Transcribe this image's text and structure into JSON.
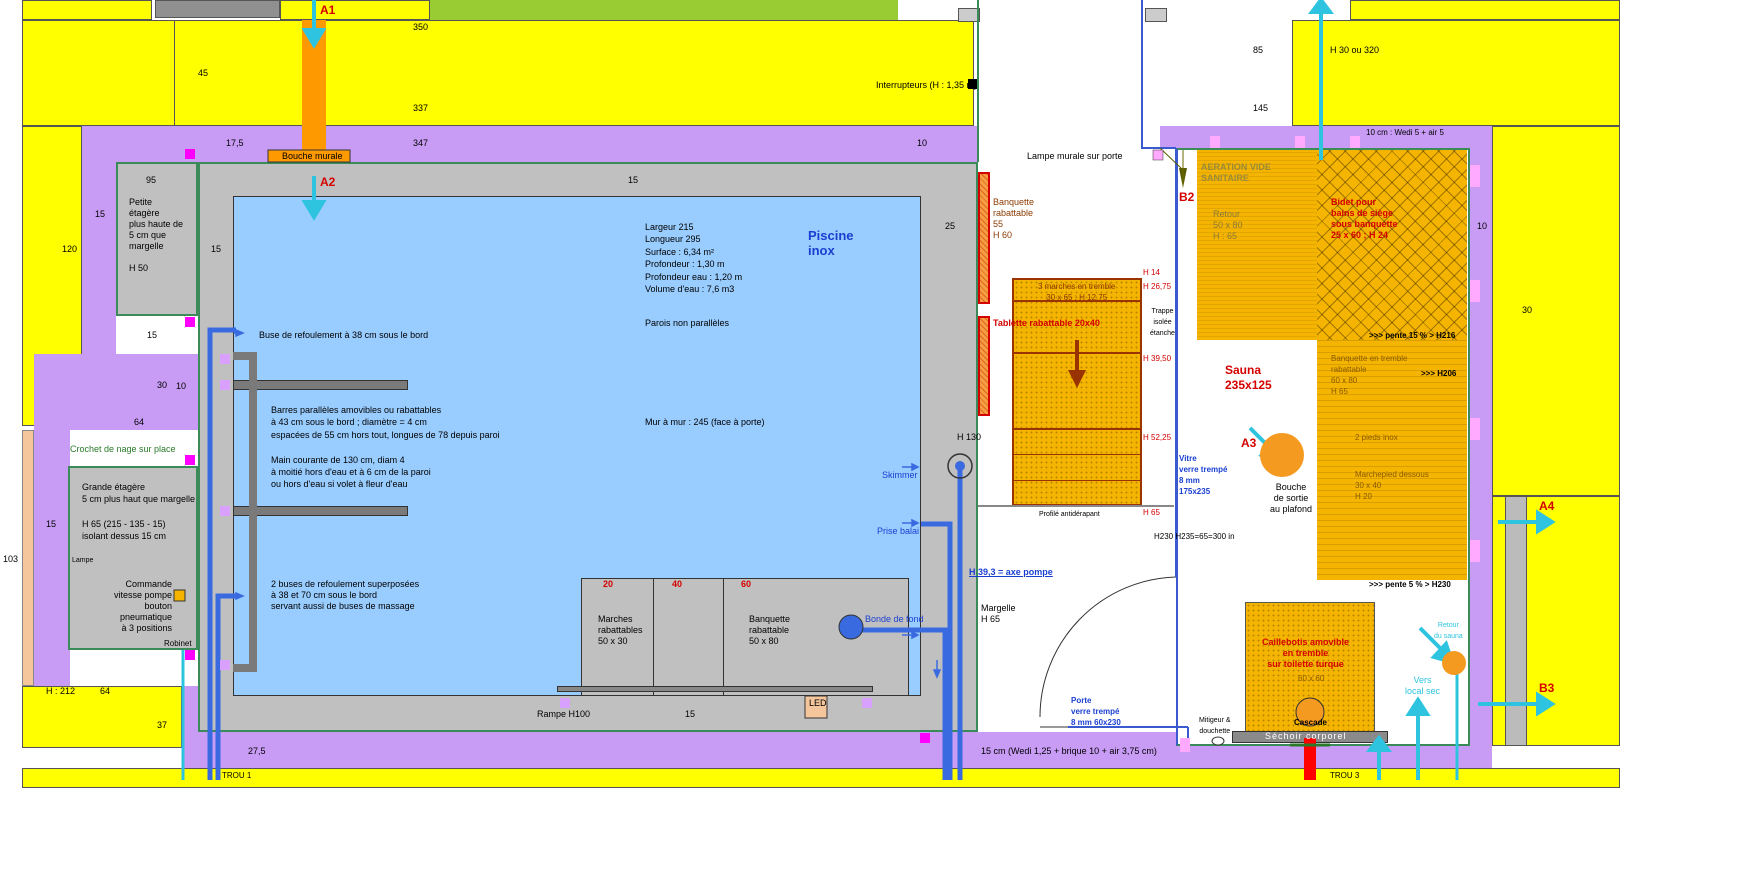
{
  "colors": {
    "yellow": "#ffff00",
    "purple": "#c89bf5",
    "grey": "#c0c0c0",
    "pool": "#99ccff",
    "wood": "#f5b400",
    "arrow_cyan": "#2ec4e0",
    "dark_blue": "#1a3fd0",
    "red": "#d40000",
    "magenta": "#ff00ff",
    "green_border": "#3a8a5a"
  },
  "markers": {
    "a1": "A1",
    "a2": "A2",
    "a3": "A3",
    "a4": "A4",
    "b2": "B2",
    "b3": "B3"
  },
  "dims": {
    "d350": "350",
    "d45": "45",
    "d337": "337",
    "d17_5": "17,5",
    "d347": "347",
    "d10a": "10",
    "d95": "95",
    "d15a": "15",
    "d120": "120",
    "d15b": "15",
    "d15c": "15",
    "d30": "30",
    "d10b": "10",
    "d64a": "64",
    "d15d": "15",
    "d103": "103",
    "d212": "H : 212",
    "d64b": "64",
    "d37": "37",
    "d27_5": "27,5",
    "d15e": "15",
    "d25": "25",
    "d15f": "15",
    "d85": "85",
    "d145": "145",
    "d10c": "10",
    "d30b": "30",
    "h30_320": "H 30 ou 320"
  },
  "labels": {
    "interrupteurs": "Interrupteurs (H : 1,35 m)",
    "bouche_murale": "Bouche murale",
    "lampe_murale": "Lampe murale sur porte",
    "petite_etagere": "Petite\nétagère\nplus haute de\n5 cm que\nmargelle\n\nH 50",
    "buse_refoulement": "Buse de refoulement à 38 cm sous le bord",
    "barres": "Barres parallèles amovibles ou rabattables\nà 43 cm sous le bord ; diamètre = 4 cm\nespacées de 55 cm hors tout, longues de 78 depuis paroi\n\nMain courante de 130 cm, diam 4\nà moitié hors d'eau et à 6 cm de la paroi\nou hors d'eau si volet à fleur d'eau",
    "crochet": "Crochet de nage sur place",
    "grande_etagere": "Grande étagère\n5 cm plus haut que margelle\n\nH 65 (215 - 135 - 15)\nisolant dessus 15 cm",
    "lampe": "Lampe",
    "commande": "Commande\nvitesse pompe\nbouton pneumatique\nà 3 positions",
    "robinet": "Robinet",
    "deux_buses": "2 buses de refoulement superposées\nà 38 et 70 cm sous le bord\nservant aussi de buses de massage",
    "pool_specs": "Largeur 215\nLongueur 295\nSurface : 6,34 m²\nProfondeur : 1,30 m\nProfondeur eau : 1,20 m\nVolume d'eau : 7,6 m3",
    "parois": "Parois non parallèles",
    "mur_a_mur": "Mur à mur : 245 (face à porte)",
    "piscine": "Piscine\ninox",
    "skimmer": "Skimmer",
    "prise_balai": "Prise balai",
    "bonde": "Bonde de fond",
    "marches": "Marches\nrabattables\n50 x 30",
    "banquette_rab": "Banquette\nrabattable\n50 x 80",
    "step20": "20",
    "step40": "40",
    "step60": "60",
    "rampe": "Rampe H100",
    "led": "LED",
    "h130": "H 130",
    "banquette_55": "Banquette\nrabattable\n55\nH 60",
    "tablette": "Tablette rabattable 20x40",
    "marches_tremble": "3 marches en tremble\n30 x 65 ; H 12,75",
    "h14": "H 14",
    "h26": "H 26,75",
    "h39": "H 39,50",
    "h52": "H 52,25",
    "h65": "H 65",
    "trappe": "Trappe\nisolée\nétanche",
    "profile": "Profilé antidérapant",
    "h39_3": "H 39,3 = axe pompe",
    "margelle": "Margelle\nH 65",
    "verre_60": "Porte\nverre trempé\n8 mm 60x230",
    "mitigeur": "Mitigeur &\ndouchette",
    "h230": "H230  H235=65=300 in",
    "vitre": "Vitre\nverre trempé\n8 mm\n175x235",
    "sauna": "Sauna\n235x125",
    "bouche_sortie": "Bouche\nde sortie\nau plafond",
    "aeration": "AERATION VIDE\nSANITAIRE",
    "retour": "Retour\n50 x 80\nH : 65",
    "bidet": "Bidet pour\nbains de siège\nsous banquette\n25 x 60 ; H 24",
    "pente15": ">>> pente 15 % > H216",
    "banquette_tremble": "Banquette en tremble\nrabattable\n60 x 80\nH 65",
    "h206": ">>> H206",
    "pieds": "2 pieds inox",
    "marchepied": "Marchepied dessous\n30 x 40\nH 20",
    "pente5": ">>> pente 5 % > H230",
    "caillebotis": "Caillebotis amovible\nen tremble\nsur toilette turque",
    "caill_dim": "60 x 60",
    "cascade": "Cascade",
    "sechoir": "Séchoir corporel",
    "retour_sauna": "Retour\ndu sauna",
    "vers_local": "Vers\nlocal sec",
    "wedi5": "10 cm : Wedi 5 + air 5",
    "wedi_bottom": "15 cm (Wedi 1,25 + brique 10 + air 3,75 cm)",
    "trou1": "TROU 1",
    "trou3": "TROU 3"
  }
}
